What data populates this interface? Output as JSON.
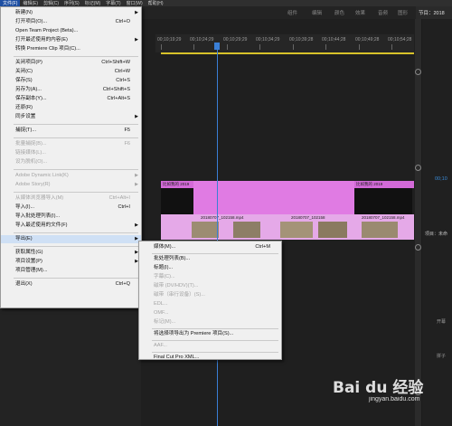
{
  "menubar": {
    "items": [
      "文件(F)",
      "编辑(E)",
      "剪辑(C)",
      "序列(S)",
      "标记(M)",
      "字幕(T)",
      "窗口(W)",
      "帮助(H)"
    ]
  },
  "workspace": {
    "tabs": [
      "组件",
      "编辑",
      "颜色",
      "效果",
      "音频",
      "图形",
      "库"
    ],
    "right_tab": "节目：2018"
  },
  "timeline": {
    "timecodes": [
      "00;10;19;29",
      "00;10;24;29",
      "00;10;29;29",
      "00;10;34;29",
      "00;10;39;28",
      "00;10;44;28",
      "00;10;49;28",
      "00;10;54;28"
    ],
    "v2_clip_a": "比如我的 2019",
    "v2_clip_b": "比如我的 2019",
    "v1_clips": [
      "20180707_102158.mp4",
      "20180707_102158",
      "20180707_102158.mp4"
    ]
  },
  "right_panel": {
    "timecode": "00;10",
    "tab2": "项目：未命",
    "label_a": "开幕",
    "label_b": "拼子"
  },
  "menu_file": {
    "items": [
      {
        "label": "新建(N)",
        "shortcut": "",
        "arrow": true,
        "disabled": false
      },
      {
        "label": "打开项目(O)...",
        "shortcut": "Ctrl+O",
        "arrow": false,
        "disabled": false
      },
      {
        "label": "Open Team Project (Beta)...",
        "shortcut": "",
        "arrow": false,
        "disabled": false
      },
      {
        "label": "打开最近使用的内容(E)",
        "shortcut": "",
        "arrow": true,
        "disabled": false
      },
      {
        "label": "转换 Premiere Clip 项目(C)...",
        "shortcut": "",
        "arrow": false,
        "disabled": false
      },
      {
        "label": "关闭项目(P)",
        "shortcut": "Ctrl+Shift+W",
        "arrow": false,
        "disabled": false
      },
      {
        "label": "关闭(C)",
        "shortcut": "Ctrl+W",
        "arrow": false,
        "disabled": false
      },
      {
        "label": "保存(S)",
        "shortcut": "Ctrl+S",
        "arrow": false,
        "disabled": false
      },
      {
        "label": "另存为(A)...",
        "shortcut": "Ctrl+Shift+S",
        "arrow": false,
        "disabled": false
      },
      {
        "label": "保存副本(Y)...",
        "shortcut": "Ctrl+Alt+S",
        "arrow": false,
        "disabled": false
      },
      {
        "label": "还原(R)",
        "shortcut": "",
        "arrow": false,
        "disabled": false
      },
      {
        "label": "同步设置",
        "shortcut": "",
        "arrow": true,
        "disabled": false
      },
      {
        "label": "捕捉(T)...",
        "shortcut": "F5",
        "arrow": false,
        "disabled": false
      },
      {
        "label": "批量捕捉(B)...",
        "shortcut": "F6",
        "arrow": false,
        "disabled": true
      },
      {
        "label": "链接媒体(L)...",
        "shortcut": "",
        "arrow": false,
        "disabled": true
      },
      {
        "label": "设为脱机(O)...",
        "shortcut": "",
        "arrow": false,
        "disabled": true
      },
      {
        "label": "Adobe Dynamic Link(K)",
        "shortcut": "",
        "arrow": true,
        "disabled": true
      },
      {
        "label": "Adobe Story(R)",
        "shortcut": "",
        "arrow": true,
        "disabled": true
      },
      {
        "label": "从媒体浏览器导入(M)",
        "shortcut": "Ctrl+Alt+I",
        "arrow": false,
        "disabled": true
      },
      {
        "label": "导入(I)...",
        "shortcut": "Ctrl+I",
        "arrow": false,
        "disabled": false
      },
      {
        "label": "导入批处理列表(I)...",
        "shortcut": "",
        "arrow": false,
        "disabled": false
      },
      {
        "label": "导入最近使用的文件(F)",
        "shortcut": "",
        "arrow": true,
        "disabled": false
      },
      {
        "label": "导出(E)",
        "shortcut": "",
        "arrow": true,
        "disabled": false
      },
      {
        "label": "获取属性(G)",
        "shortcut": "",
        "arrow": true,
        "disabled": false
      },
      {
        "label": "项目设置(P)",
        "shortcut": "",
        "arrow": true,
        "disabled": false
      },
      {
        "label": "项目管理(M)...",
        "shortcut": "",
        "arrow": false,
        "disabled": false
      },
      {
        "label": "退出(X)",
        "shortcut": "Ctrl+Q",
        "arrow": false,
        "disabled": false
      }
    ]
  },
  "menu_export": {
    "items": [
      {
        "label": "媒体(M)...",
        "shortcut": "Ctrl+M",
        "disabled": false
      },
      {
        "label": "批处理列表(B)...",
        "shortcut": "",
        "disabled": false
      },
      {
        "label": "标题(I)...",
        "shortcut": "",
        "disabled": false
      },
      {
        "label": "字幕(C)...",
        "shortcut": "",
        "disabled": true
      },
      {
        "label": "磁带 (DV/HDV)(T)...",
        "shortcut": "",
        "disabled": true
      },
      {
        "label": "磁带（串行设备）(S)...",
        "shortcut": "",
        "disabled": true
      },
      {
        "label": "EDL...",
        "shortcut": "",
        "disabled": true
      },
      {
        "label": "OMF...",
        "shortcut": "",
        "disabled": true
      },
      {
        "label": "标记(M)...",
        "shortcut": "",
        "disabled": true
      },
      {
        "label": "将选择项导出为 Premiere 项目(S)...",
        "shortcut": "",
        "disabled": false
      },
      {
        "label": "AAF...",
        "shortcut": "",
        "disabled": true
      },
      {
        "label": "Final Cut Pro XML...",
        "shortcut": "",
        "disabled": false
      }
    ]
  },
  "watermark": {
    "text": "Bai du 经验",
    "sub": "jingyan.baidu.com"
  }
}
